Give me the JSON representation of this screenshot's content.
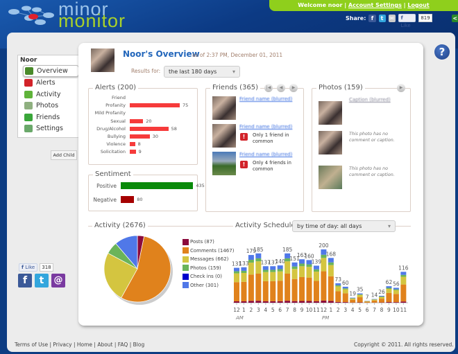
{
  "header": {
    "logo_line1": "minor",
    "logo_line2": "monitor",
    "welcome": "Welcome  noor",
    "account_settings": "Account Settings",
    "logout": "Logout",
    "share_label": "Share:",
    "like_label": "Like",
    "like_count": "819"
  },
  "sidebar": {
    "child_name": "Noor",
    "items": [
      {
        "label": "Overview",
        "icon": "overview-icon",
        "color": "#4a8a2a"
      },
      {
        "label": "Alerts",
        "icon": "alert-icon",
        "color": "#d2232a"
      },
      {
        "label": "Activity",
        "icon": "activity-icon",
        "color": "#5fb33a"
      },
      {
        "label": "Photos",
        "icon": "photos-icon",
        "color": "#8fb080"
      },
      {
        "label": "Friends",
        "icon": "friends-icon",
        "color": "#3aa63a"
      },
      {
        "label": "Settings",
        "icon": "settings-icon",
        "color": "#6aa86a"
      }
    ],
    "add_child": "Add Child",
    "like_label": "Like",
    "like_count": "318"
  },
  "overview": {
    "title": "Noor's Overview",
    "as_of": "as of 2:37 PM, December 01, 2011",
    "results_for_label": "Results for:",
    "results_for_value": "the last 180 days"
  },
  "alerts": {
    "title": "Alerts (200)",
    "items": [
      {
        "label": "Friend",
        "value": null
      },
      {
        "label": "Profanity",
        "value": 75
      },
      {
        "label": "Mild Profanity",
        "value": null
      },
      {
        "label": "Sexual",
        "value": 20
      },
      {
        "label": "Drug/Alcohol",
        "value": 58
      },
      {
        "label": "Bullying",
        "value": 30
      },
      {
        "label": "Violence",
        "value": 8
      },
      {
        "label": "Solicitation",
        "value": 9
      }
    ]
  },
  "sentiment": {
    "title": "Sentiment",
    "items": [
      {
        "label": "Positive",
        "value": 435,
        "color": "#0a8a0a"
      },
      {
        "label": "Negative",
        "value": 80,
        "color": "#a50000"
      }
    ]
  },
  "friends": {
    "title": "Friends (365)",
    "items": [
      {
        "name": "Friend name (blurred)",
        "note": ""
      },
      {
        "name": "Friend name (blurred)",
        "note": "Only 1 friend in common"
      },
      {
        "name": "Friend name (blurred)",
        "note": "Only 4 friends in common"
      }
    ]
  },
  "photos": {
    "title": "Photos (159)",
    "items": [
      {
        "caption": "Caption (blurred)"
      },
      {
        "caption": "This photo has no comment or caption."
      },
      {
        "caption": "This photo has no comment or caption."
      }
    ]
  },
  "activity": {
    "title": "Activity (2676)",
    "legend": [
      {
        "label": "Posts (87)",
        "value": 87,
        "color": "#8b0a3c"
      },
      {
        "label": "Comments (1467)",
        "value": 1467,
        "color": "#e0821c"
      },
      {
        "label": "Messages (662)",
        "value": 662,
        "color": "#d4c540"
      },
      {
        "label": "Photos (159)",
        "value": 159,
        "color": "#6ab45a"
      },
      {
        "label": "Check ins (0)",
        "value": 0,
        "color": "#0000cc"
      },
      {
        "label": "Other (301)",
        "value": 301,
        "color": "#5078e8"
      }
    ]
  },
  "schedule": {
    "title": "Activity Schedule",
    "filter": "by time of day: all days",
    "am": "AM",
    "pm": "PM"
  },
  "chart_data": {
    "type": "bar",
    "stacked": true,
    "categories": [
      "12",
      "1",
      "2",
      "3",
      "4",
      "5",
      "6",
      "7",
      "8",
      "9",
      "10",
      "11",
      "12",
      "1",
      "2",
      "3",
      "4",
      "5",
      "6",
      "7",
      "8",
      "9",
      "10",
      "11"
    ],
    "totals": [
      131,
      133,
      179,
      185,
      137,
      137,
      140,
      185,
      151,
      163,
      160,
      139,
      200,
      168,
      73,
      60,
      19,
      35,
      7,
      14,
      26,
      62,
      56,
      116
    ],
    "ylim": [
      0,
      200
    ]
  },
  "footer": {
    "links": [
      "Terms of Use",
      "Privacy",
      "Home",
      "About",
      "FAQ",
      "Blog"
    ],
    "copyright": "Copyright © 2011. All rights reserved."
  }
}
